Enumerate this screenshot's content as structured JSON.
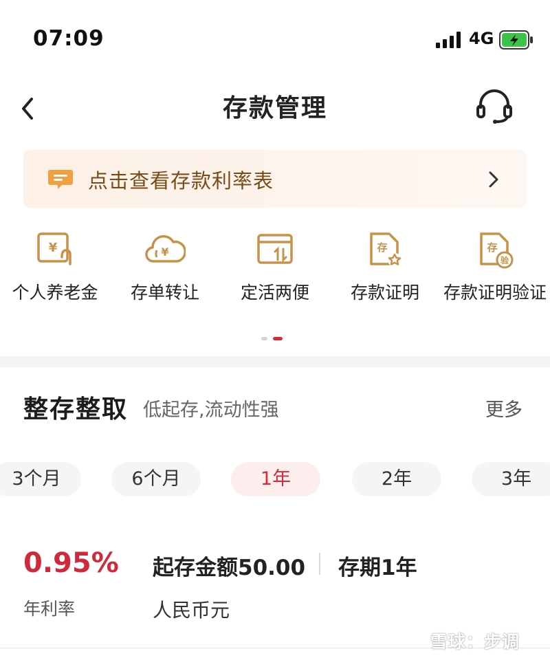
{
  "status_bar": {
    "time": "07:09",
    "network": "4G"
  },
  "header": {
    "title": "存款管理",
    "back_icon": "chevron-left-icon",
    "support_icon": "headset-icon"
  },
  "banner": {
    "text": "点击查看存款利率表",
    "icon": "message-icon",
    "accent": "#7a4a16"
  },
  "quick_actions": [
    {
      "label": "个人养老金",
      "icon": "pension-icon"
    },
    {
      "label": "存单转让",
      "icon": "cloud-yen-icon"
    },
    {
      "label": "定活两便",
      "icon": "transfer-card-icon"
    },
    {
      "label": "存款证明",
      "icon": "deposit-certificate-icon"
    },
    {
      "label": "存款证明验证",
      "icon": "certificate-verify-icon"
    }
  ],
  "pager": {
    "pages": 2,
    "active": 2
  },
  "product": {
    "title": "整存整取",
    "subtitle": "低起存,流动性强",
    "more": "更多",
    "terms": [
      "3个月",
      "6个月",
      "1年",
      "2年",
      "3年"
    ],
    "selected_term": "1年",
    "rate": "0.95%",
    "rate_label": "年利率",
    "min_amount": "起存金额50.00",
    "period": "存期1年",
    "currency": "人民币元"
  },
  "watermark": "雪球：步调",
  "colors": {
    "accent_red": "#d62b3a",
    "rate_red": "#cf2a3c",
    "gold": "#c8914a"
  }
}
